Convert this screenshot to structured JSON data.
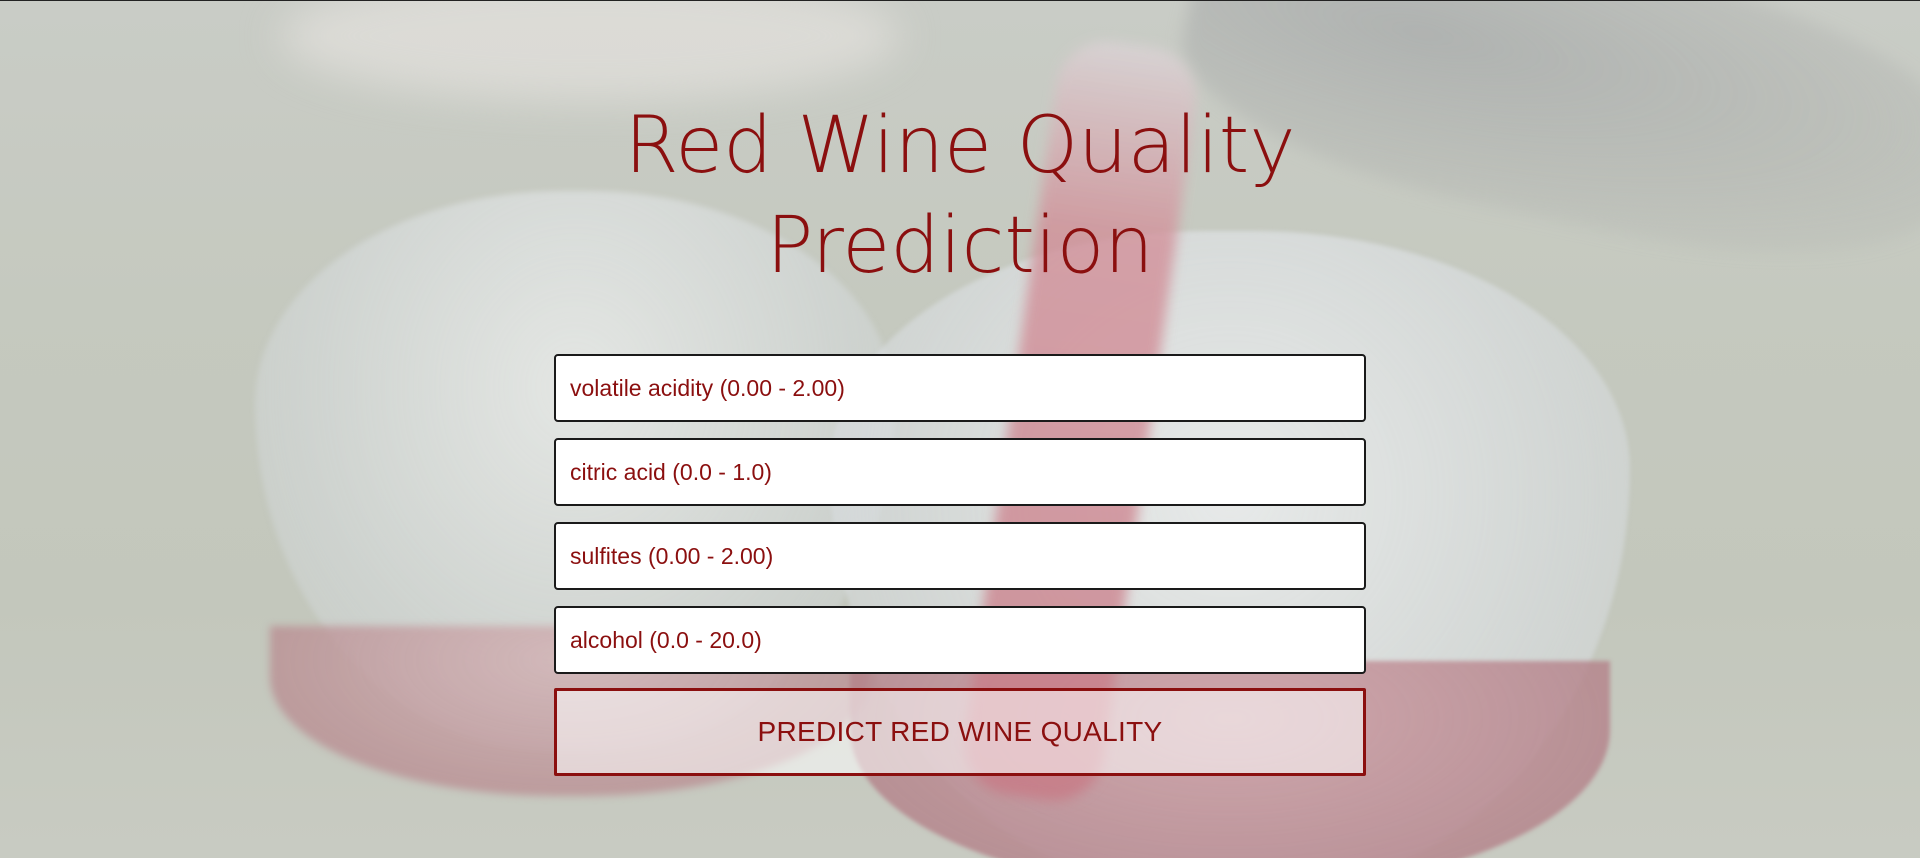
{
  "page": {
    "title": "Red Wine Quality Prediction"
  },
  "form": {
    "fields": [
      {
        "name": "volatile-acidity",
        "value": "",
        "placeholder": "volatile acidity (0.00 - 2.00)"
      },
      {
        "name": "citric-acid",
        "value": "",
        "placeholder": "citric acid (0.0 - 1.0)"
      },
      {
        "name": "sulfites",
        "value": "",
        "placeholder": "sulfites (0.00 - 2.00)"
      },
      {
        "name": "alcohol",
        "value": "",
        "placeholder": "alcohol (0.0 - 20.0)"
      }
    ],
    "submit_label": "PREDICT RED WINE QUALITY"
  },
  "background": {
    "description_icon": "wine-pour-photo"
  },
  "colors": {
    "accent": "#8b0f0f",
    "field_background": "#ffffff",
    "field_border": "#1a1a1a"
  }
}
